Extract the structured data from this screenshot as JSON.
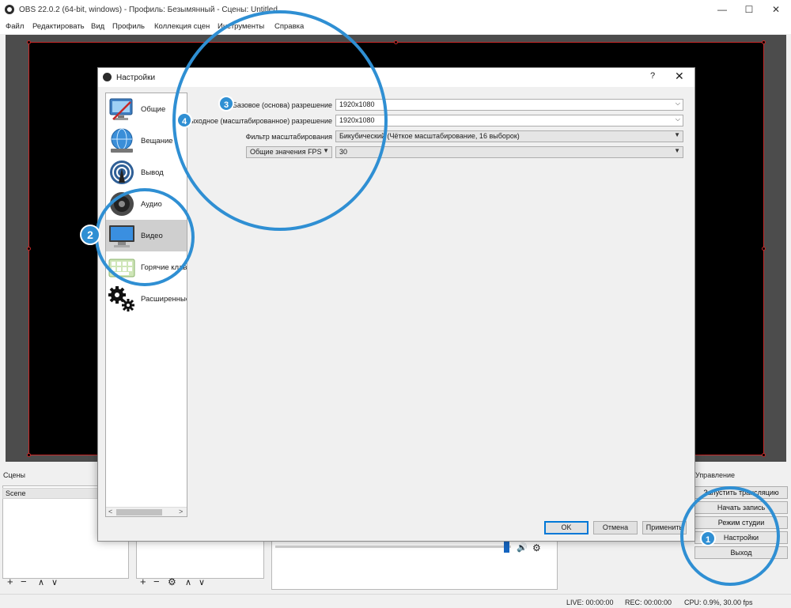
{
  "window": {
    "title": "OBS 22.0.2 (64-bit, windows) - Профиль: Безымянный - Сцены: Untitled",
    "minimize": "—",
    "maximize": "☐",
    "close": "✕"
  },
  "menu": [
    "Файл",
    "Редактировать",
    "Вид",
    "Профиль",
    "Коллекция сцен",
    "Инструменты",
    "Справка"
  ],
  "docks": {
    "scenes_title": "Сцены",
    "scene_item": "Scene",
    "controls_title": "Управление",
    "controls": [
      "Запустить трансляцию",
      "Начать запись",
      "Режим студии",
      "Настройки",
      "Выход"
    ]
  },
  "tools": {
    "add": "+",
    "remove": "−",
    "up": "∧",
    "down": "∨",
    "gear": "⚙"
  },
  "mixer": {
    "volume": 0.98,
    "speaker": "🔊",
    "gear": "⚙"
  },
  "status": {
    "live": "LIVE: 00:00:00",
    "rec": "REC: 00:00:00",
    "cpu": "CPU: 0.9%, 30.00 fps"
  },
  "dialog": {
    "title": "Настройки",
    "help": "?",
    "close": "✕",
    "sidebar": [
      {
        "label": "Общие",
        "icon": "general-icon"
      },
      {
        "label": "Вещание",
        "icon": "stream-icon"
      },
      {
        "label": "Вывод",
        "icon": "output-icon"
      },
      {
        "label": "Аудио",
        "icon": "audio-icon"
      },
      {
        "label": "Видео",
        "icon": "video-icon",
        "active": true
      },
      {
        "label": "Горячие клавиши",
        "icon": "hotkeys-icon"
      },
      {
        "label": "Расширенные",
        "icon": "advanced-icon"
      }
    ],
    "scroll_left": "<",
    "scroll_right": ">",
    "fields": {
      "base_label": "Базовое (основа) разрешение",
      "base_value": "1920x1080",
      "output_label": "Выходное (масштабированное) разрешение",
      "output_value": "1920x1080",
      "filter_label": "Фильтр масштабирования",
      "filter_value": "Бикубический (Чёткое масштабирование, 16 выборок)",
      "fps_mode": "Общие значения FPS",
      "fps_value": "30"
    },
    "buttons": {
      "ok": "OK",
      "cancel": "Отмена",
      "apply": "Применить"
    }
  },
  "annotations": {
    "accent": "#2f8fd3",
    "badges": [
      "1",
      "2",
      "3",
      "4"
    ]
  }
}
